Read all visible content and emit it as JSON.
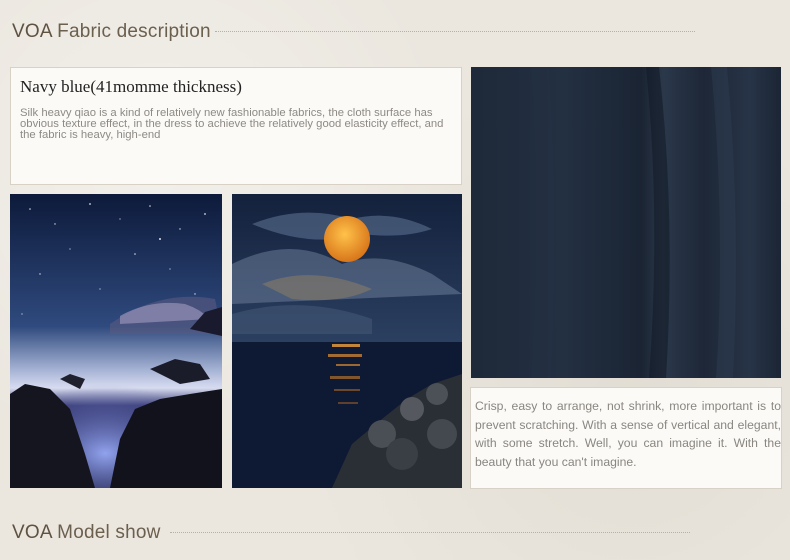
{
  "fabric_section": {
    "brand": "VOA",
    "title": "Fabric description"
  },
  "description": {
    "heading": "Navy blue(41momme thickness)",
    "body": "Silk heavy qiao is a kind of relatively new fashionable fabrics, the cloth surface has obvious texture effect, in the dress to achieve the relatively good elasticity effect, and the fabric is heavy, high-end"
  },
  "feature_text": "Crisp, easy to arrange, not shrink, more important is to prevent scratching. With a sense of vertical and elegant, with some stretch. Well, you can imagine it. With the beauty that you can't imagine.",
  "model_section": {
    "brand": "VOA",
    "title": "Model show"
  },
  "colors": {
    "fabric": "#1f2a3a",
    "title_text": "#6b5f4e",
    "background": "#ebe7df"
  }
}
